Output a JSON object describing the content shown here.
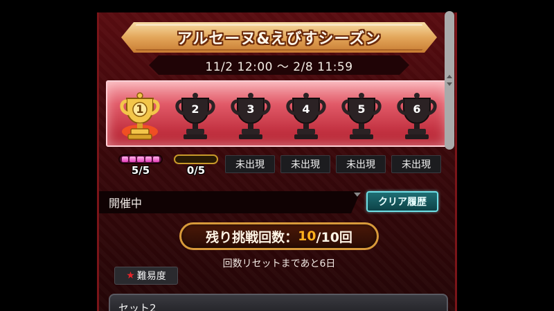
{
  "event": {
    "title": "アルセーヌ&えびすシーズン",
    "period": "11/2 12:00 ～ 2/8 11:59"
  },
  "trophies": [
    {
      "number": "1",
      "state": "gold"
    },
    {
      "number": "2",
      "state": "locked"
    },
    {
      "number": "3",
      "state": "locked"
    },
    {
      "number": "4",
      "state": "locked"
    },
    {
      "number": "5",
      "state": "locked"
    },
    {
      "number": "6",
      "state": "locked"
    }
  ],
  "gauges": [
    {
      "count": "5/5",
      "filled": 5,
      "total": 5,
      "color": "#e23fb8"
    },
    {
      "count": "0/5",
      "filled": 0,
      "total": 5,
      "color": "#c99a2a"
    }
  ],
  "unreleased_label": "未出現",
  "status": {
    "label": "開催中",
    "history_button": "クリア履歴"
  },
  "tries": {
    "label": "残り挑戦回数：",
    "current": "10",
    "rest": "/10回"
  },
  "reset_note": "回数リセットまであと6日",
  "difficulty_label": "難易度",
  "set": {
    "label": "セット2"
  },
  "colors": {
    "panel_red": "#5a0c10",
    "gold": "#e3a65a",
    "teal_button": "#6fe0e6",
    "tries_highlight": "#ffb21e"
  }
}
